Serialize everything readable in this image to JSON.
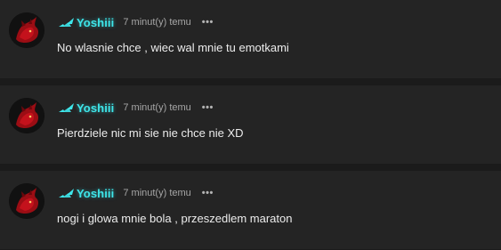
{
  "comments": [
    {
      "username": "Yoshiii",
      "time": "7 minut(y) temu",
      "more_label": "•••",
      "text": "No wlasnie chce , wiec wal mnie tu emotkami"
    },
    {
      "username": "Yoshiii",
      "time": "7 minut(y) temu",
      "more_label": "•••",
      "text": "Pierdziele nic mi sie nie chce nie XD"
    },
    {
      "username": "Yoshiii",
      "time": "7 minut(y) temu",
      "more_label": "•••",
      "text": "nogi i glowa mnie bola , przeszedlem maraton"
    }
  ],
  "colors": {
    "username": "#3ee6ea",
    "background": "#1b1b1b",
    "card": "#242424"
  },
  "icons": {
    "avatar": "red-dragon-avatar-icon",
    "rank": "rank-badge-icon",
    "more": "more-options-icon"
  }
}
